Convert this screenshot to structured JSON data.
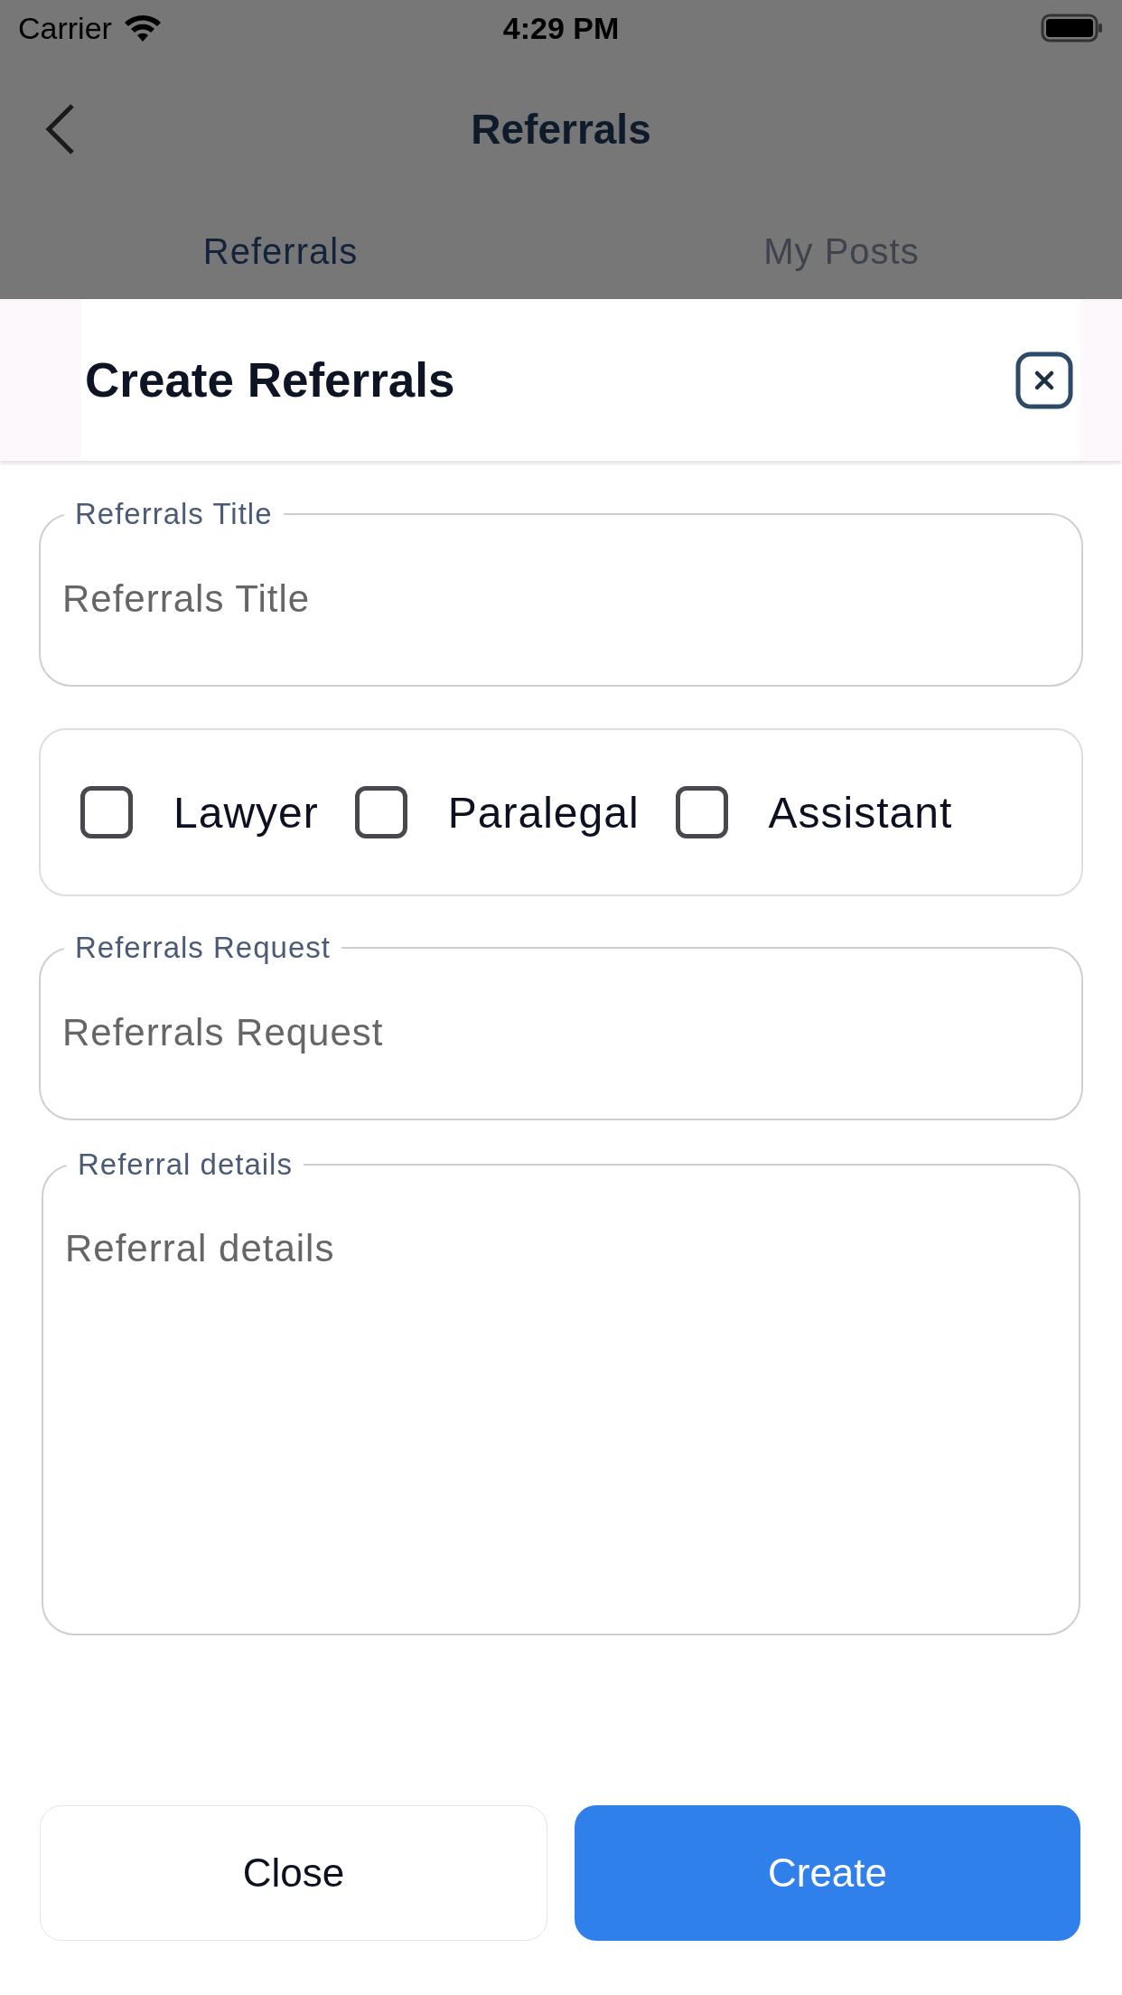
{
  "status_bar": {
    "carrier": "Carrier",
    "time": "4:29 PM"
  },
  "nav": {
    "title": "Referrals"
  },
  "tabs": [
    {
      "label": "Referrals",
      "selected": true
    },
    {
      "label": "My Posts",
      "selected": false
    }
  ],
  "sheet": {
    "title": "Create Referrals"
  },
  "form": [
    {
      "kind": "text",
      "label": "Referrals Title",
      "placeholder": "Referrals Title"
    },
    {
      "kind": "checkboxes",
      "options": [
        {
          "label": "Lawyer",
          "checked": false
        },
        {
          "label": "Paralegal",
          "checked": false
        },
        {
          "label": "Assistant",
          "checked": false
        }
      ]
    },
    {
      "kind": "text",
      "label": "Referrals Request",
      "placeholder": "Referrals Request"
    },
    {
      "kind": "textarea",
      "label": "Referral details",
      "placeholder": "Referral details"
    }
  ],
  "buttons": [
    {
      "label": "Close",
      "kind": "secondary"
    },
    {
      "label": "Create",
      "kind": "primary"
    }
  ]
}
